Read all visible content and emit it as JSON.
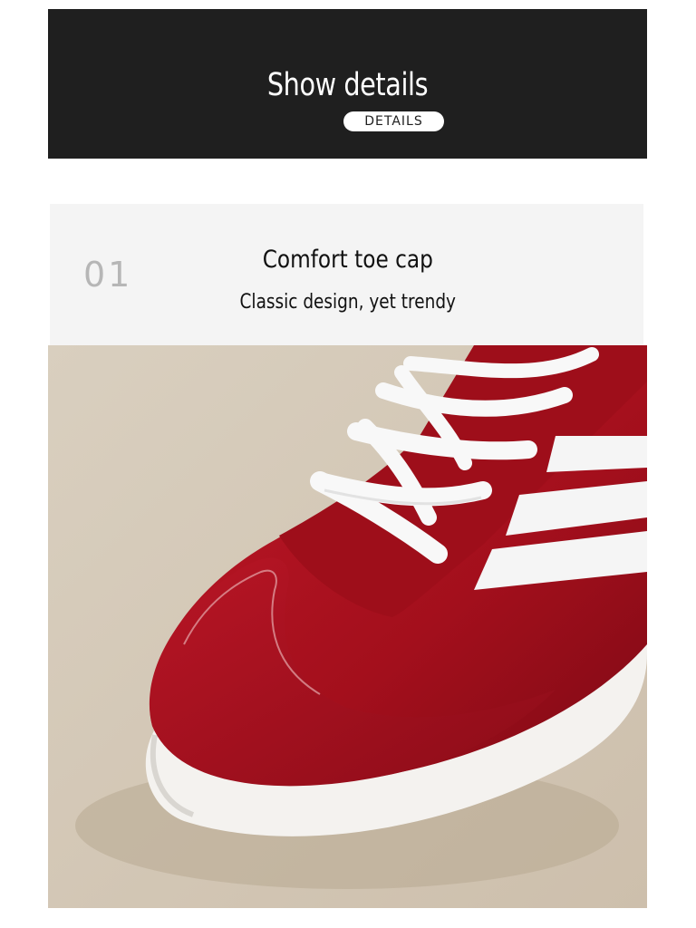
{
  "banner": {
    "title": "Show details",
    "tag": "DETAILS"
  },
  "feature": {
    "number": "01",
    "title": "Comfort toe cap",
    "subtitle": "Classic design, yet trendy"
  },
  "colors": {
    "banner_bg": "#1f1f1f",
    "feature_bg": "#f4f4f4",
    "photo_bg": "#d5c9b8",
    "shoe_red": "#a8101d",
    "shoe_white": "#f7f7f7"
  }
}
